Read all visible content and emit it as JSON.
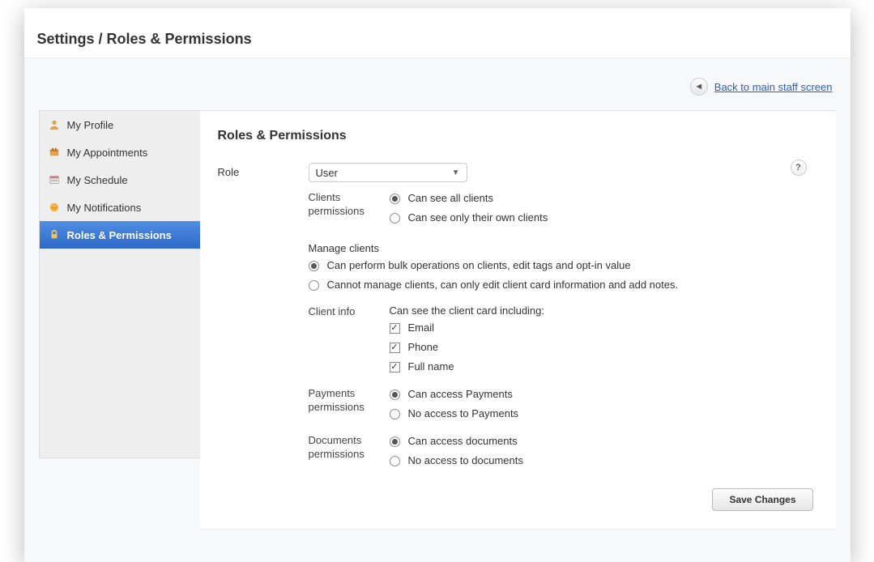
{
  "header": {
    "breadcrumb": "Settings / Roles & Permissions"
  },
  "backlink": {
    "label": "Back to main staff screen"
  },
  "sidebar": {
    "items": [
      {
        "label": "My Profile",
        "icon": "profile-icon"
      },
      {
        "label": "My Appointments",
        "icon": "appointments-icon"
      },
      {
        "label": "My Schedule",
        "icon": "schedule-icon"
      },
      {
        "label": "My Notifications",
        "icon": "notifications-icon"
      },
      {
        "label": "Roles & Permissions",
        "icon": "lock-icon",
        "active": true
      }
    ]
  },
  "panel": {
    "title": "Roles & Permissions",
    "role_label": "Role",
    "role_value": "User",
    "help_label": "?",
    "save_label": "Save Changes",
    "sections": {
      "clients_permissions": {
        "label": "Clients permissions",
        "options": [
          {
            "label": "Can see all clients",
            "selected": true
          },
          {
            "label": "Can see only their own clients",
            "selected": false
          }
        ]
      },
      "manage_clients": {
        "label": "Manage clients",
        "options": [
          {
            "label": "Can perform bulk operations on clients, edit tags and opt-in value",
            "selected": true
          },
          {
            "label": "Cannot manage clients, can only edit client card information and add notes.",
            "selected": false
          }
        ]
      },
      "client_info": {
        "label": "Client info",
        "intro": "Can see the client card including:",
        "checks": [
          {
            "label": "Email",
            "checked": true
          },
          {
            "label": "Phone",
            "checked": true
          },
          {
            "label": "Full name",
            "checked": true
          }
        ]
      },
      "payments_permissions": {
        "label": "Payments permissions",
        "options": [
          {
            "label": "Can access Payments",
            "selected": true
          },
          {
            "label": "No access to Payments",
            "selected": false
          }
        ]
      },
      "documents_permissions": {
        "label": "Documents permissions",
        "options": [
          {
            "label": "Can access documents",
            "selected": true
          },
          {
            "label": "No access to documents",
            "selected": false
          }
        ]
      }
    }
  }
}
